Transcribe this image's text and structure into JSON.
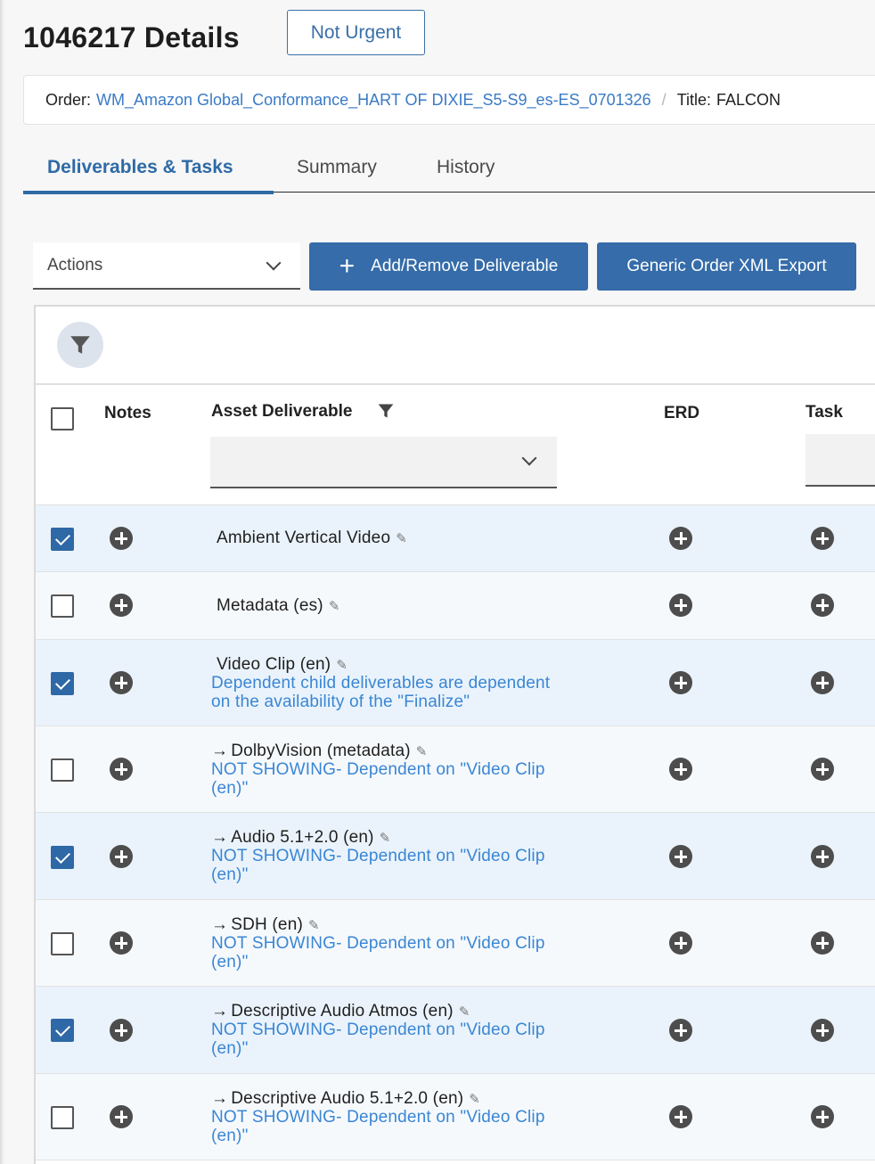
{
  "header": {
    "title": "1046217 Details",
    "urgency": "Not Urgent"
  },
  "breadcrumb": {
    "order_label": "Order:",
    "order_value": "WM_Amazon Global_Conformance_HART OF DIXIE_S5-S9_es-ES_0701326",
    "separator": "/",
    "title_label": "Title:",
    "title_value": "FALCON"
  },
  "tabs": [
    {
      "label": "Deliverables & Tasks",
      "active": true
    },
    {
      "label": "Summary",
      "active": false
    },
    {
      "label": "History",
      "active": false
    }
  ],
  "toolbar": {
    "actions_label": "Actions",
    "add_label": "Add/Remove Deliverable",
    "export_label": "Generic Order XML Export"
  },
  "columns": {
    "notes": "Notes",
    "asset": "Asset Deliverable",
    "erd": "ERD",
    "task": "Task"
  },
  "rows": [
    {
      "name": "Ambient Vertical Video",
      "child": false,
      "checked": true,
      "note": ""
    },
    {
      "name": "Metadata (es)",
      "child": false,
      "checked": false,
      "note": ""
    },
    {
      "name": "Video Clip (en)",
      "child": false,
      "checked": true,
      "note": "Dependent child deliverables are dependent on the availability of the \"Finalize\""
    },
    {
      "name": "DolbyVision (metadata)",
      "child": true,
      "checked": false,
      "note": "NOT SHOWING- Dependent on \"Video Clip (en)\""
    },
    {
      "name": "Audio 5.1+2.0 (en)",
      "child": true,
      "checked": true,
      "note": "NOT SHOWING- Dependent on \"Video Clip (en)\""
    },
    {
      "name": "SDH (en)",
      "child": true,
      "checked": false,
      "note": "NOT SHOWING- Dependent on \"Video Clip (en)\""
    },
    {
      "name": "Descriptive Audio Atmos (en)",
      "child": true,
      "checked": true,
      "note": "NOT SHOWING- Dependent on \"Video Clip (en)\""
    },
    {
      "name": "Descriptive Audio 5.1+2.0 (en)",
      "child": true,
      "checked": false,
      "note": "NOT SHOWING- Dependent on \"Video Clip (en)\""
    }
  ],
  "colors": {
    "accent": "#2e6aa6",
    "link": "#3a86d4",
    "selected_row": "#eaf3fb"
  }
}
